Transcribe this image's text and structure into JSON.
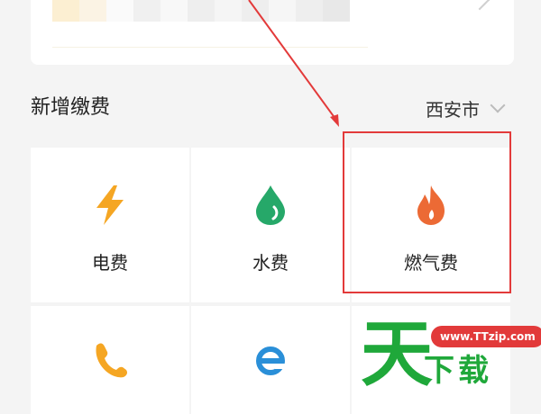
{
  "section": {
    "title": "新增缴费",
    "city": "西安市"
  },
  "services": [
    {
      "label": "电费",
      "icon": "lightning-icon",
      "color": "#f5a623"
    },
    {
      "label": "水费",
      "icon": "water-drop-icon",
      "color": "#26a869"
    },
    {
      "label": "燃气费",
      "icon": "flame-icon",
      "color": "#ec6a35"
    },
    {
      "label": "",
      "icon": "phone-icon",
      "color": "#f5a623"
    },
    {
      "label": "",
      "icon": "internet-e-icon",
      "color": "#2a8fd8"
    }
  ],
  "watermark": {
    "big_char": "天",
    "site": "www.TTzip.com",
    "sub": "下载"
  },
  "colors": {
    "annotation": "#e33a3a",
    "watermark_green": "#1fa83a"
  }
}
